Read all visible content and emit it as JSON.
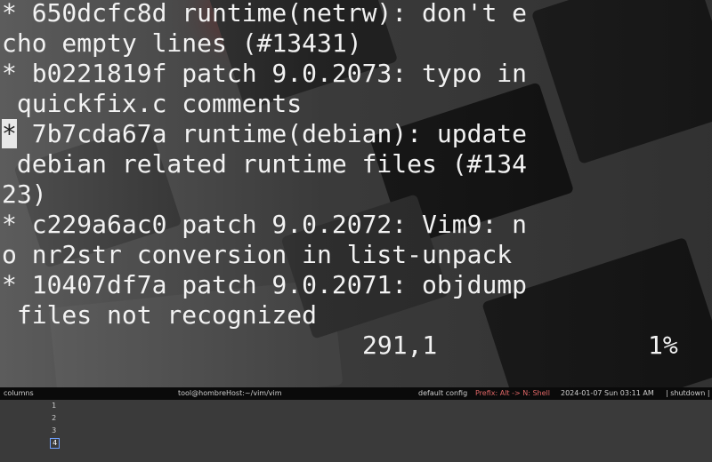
{
  "terminal": {
    "lines": [
      "* 650dcfc8d runtime(netrw): don't e",
      "cho empty lines (#13431)",
      "* b0221819f patch 9.0.2073: typo in",
      " quickfix.c comments",
      " 7b7cda67a runtime(debian): update",
      " debian related runtime files (#134",
      "23)",
      "* c229a6ac0 patch 9.0.2072: Vim9: n",
      "o nr2str conversion in list-unpack",
      "* 10407df7a patch 9.0.2071: objdump",
      " files not recognized"
    ],
    "cursor_char": "*",
    "ruler_position": "291,1",
    "ruler_percent": "1%"
  },
  "statusbar": {
    "columns_label": "columns",
    "workspaces": [
      "1",
      "2",
      "3",
      "4"
    ],
    "active_workspace": "4",
    "window_title": "tool@hombreHost:~/vim/vim",
    "config_label": "default config",
    "mode_label": "Prefix: Alt -> N: Shell",
    "datetime": "2024-01-07 Sun 03:11 AM",
    "shutdown_label": "| shutdown |"
  }
}
